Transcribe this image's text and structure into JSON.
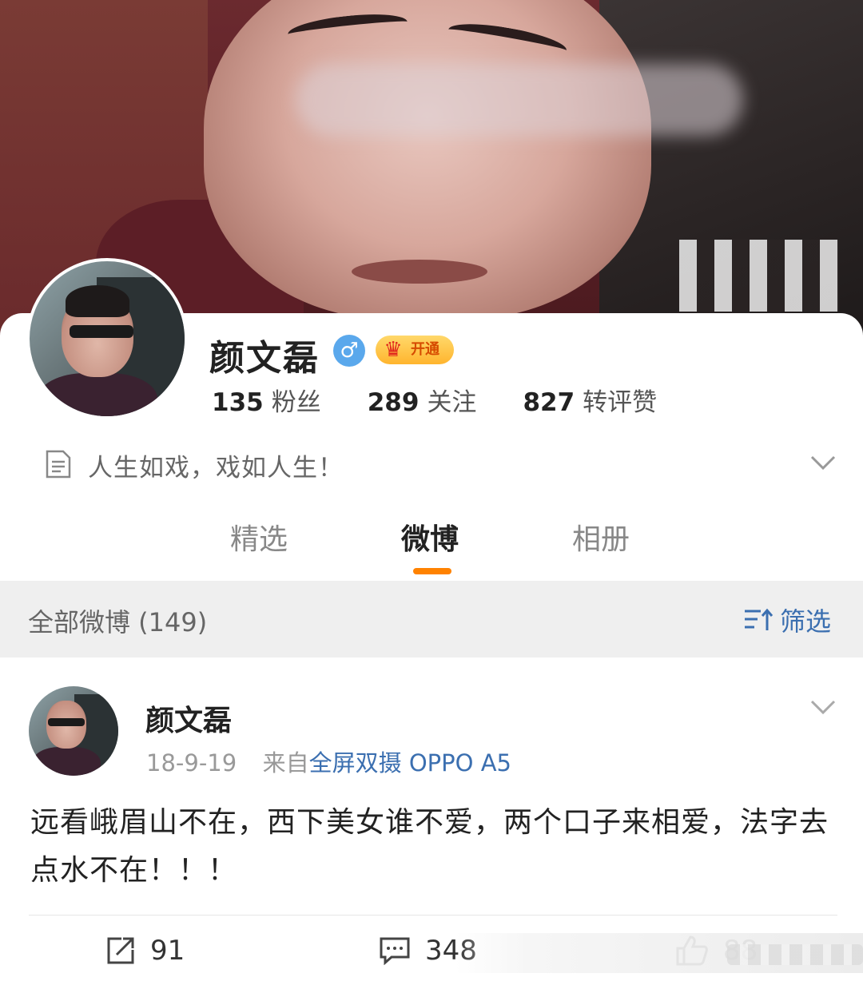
{
  "profile": {
    "name": "颜文磊",
    "gender_icon": "male-icon",
    "vip_label": "开通",
    "stats": [
      {
        "value": "135",
        "label": "粉丝"
      },
      {
        "value": "289",
        "label": "关注"
      },
      {
        "value": "827",
        "label": "转评赞"
      }
    ],
    "bio": "人生如戏，戏如人生！"
  },
  "tabs": [
    {
      "label": "精选",
      "active": false
    },
    {
      "label": "微博",
      "active": true
    },
    {
      "label": "相册",
      "active": false
    }
  ],
  "filter": {
    "title": "全部微博 (149)",
    "button_label": "筛选"
  },
  "post": {
    "author": "颜文磊",
    "date": "18-9-19",
    "source_prefix": "来自",
    "source": "全屏双摄 OPPO A5",
    "text": "远看峨眉山不在，西下美女谁不爱，两个口子来相爱，法字去点水不在！！！",
    "repost_count": "91",
    "comment_count": "348",
    "like_count": "88"
  },
  "colors": {
    "accent_orange": "#ff8200",
    "link_blue": "#3b6fb0",
    "gender_blue": "#5aa8ec",
    "filter_bg": "#efefef"
  }
}
